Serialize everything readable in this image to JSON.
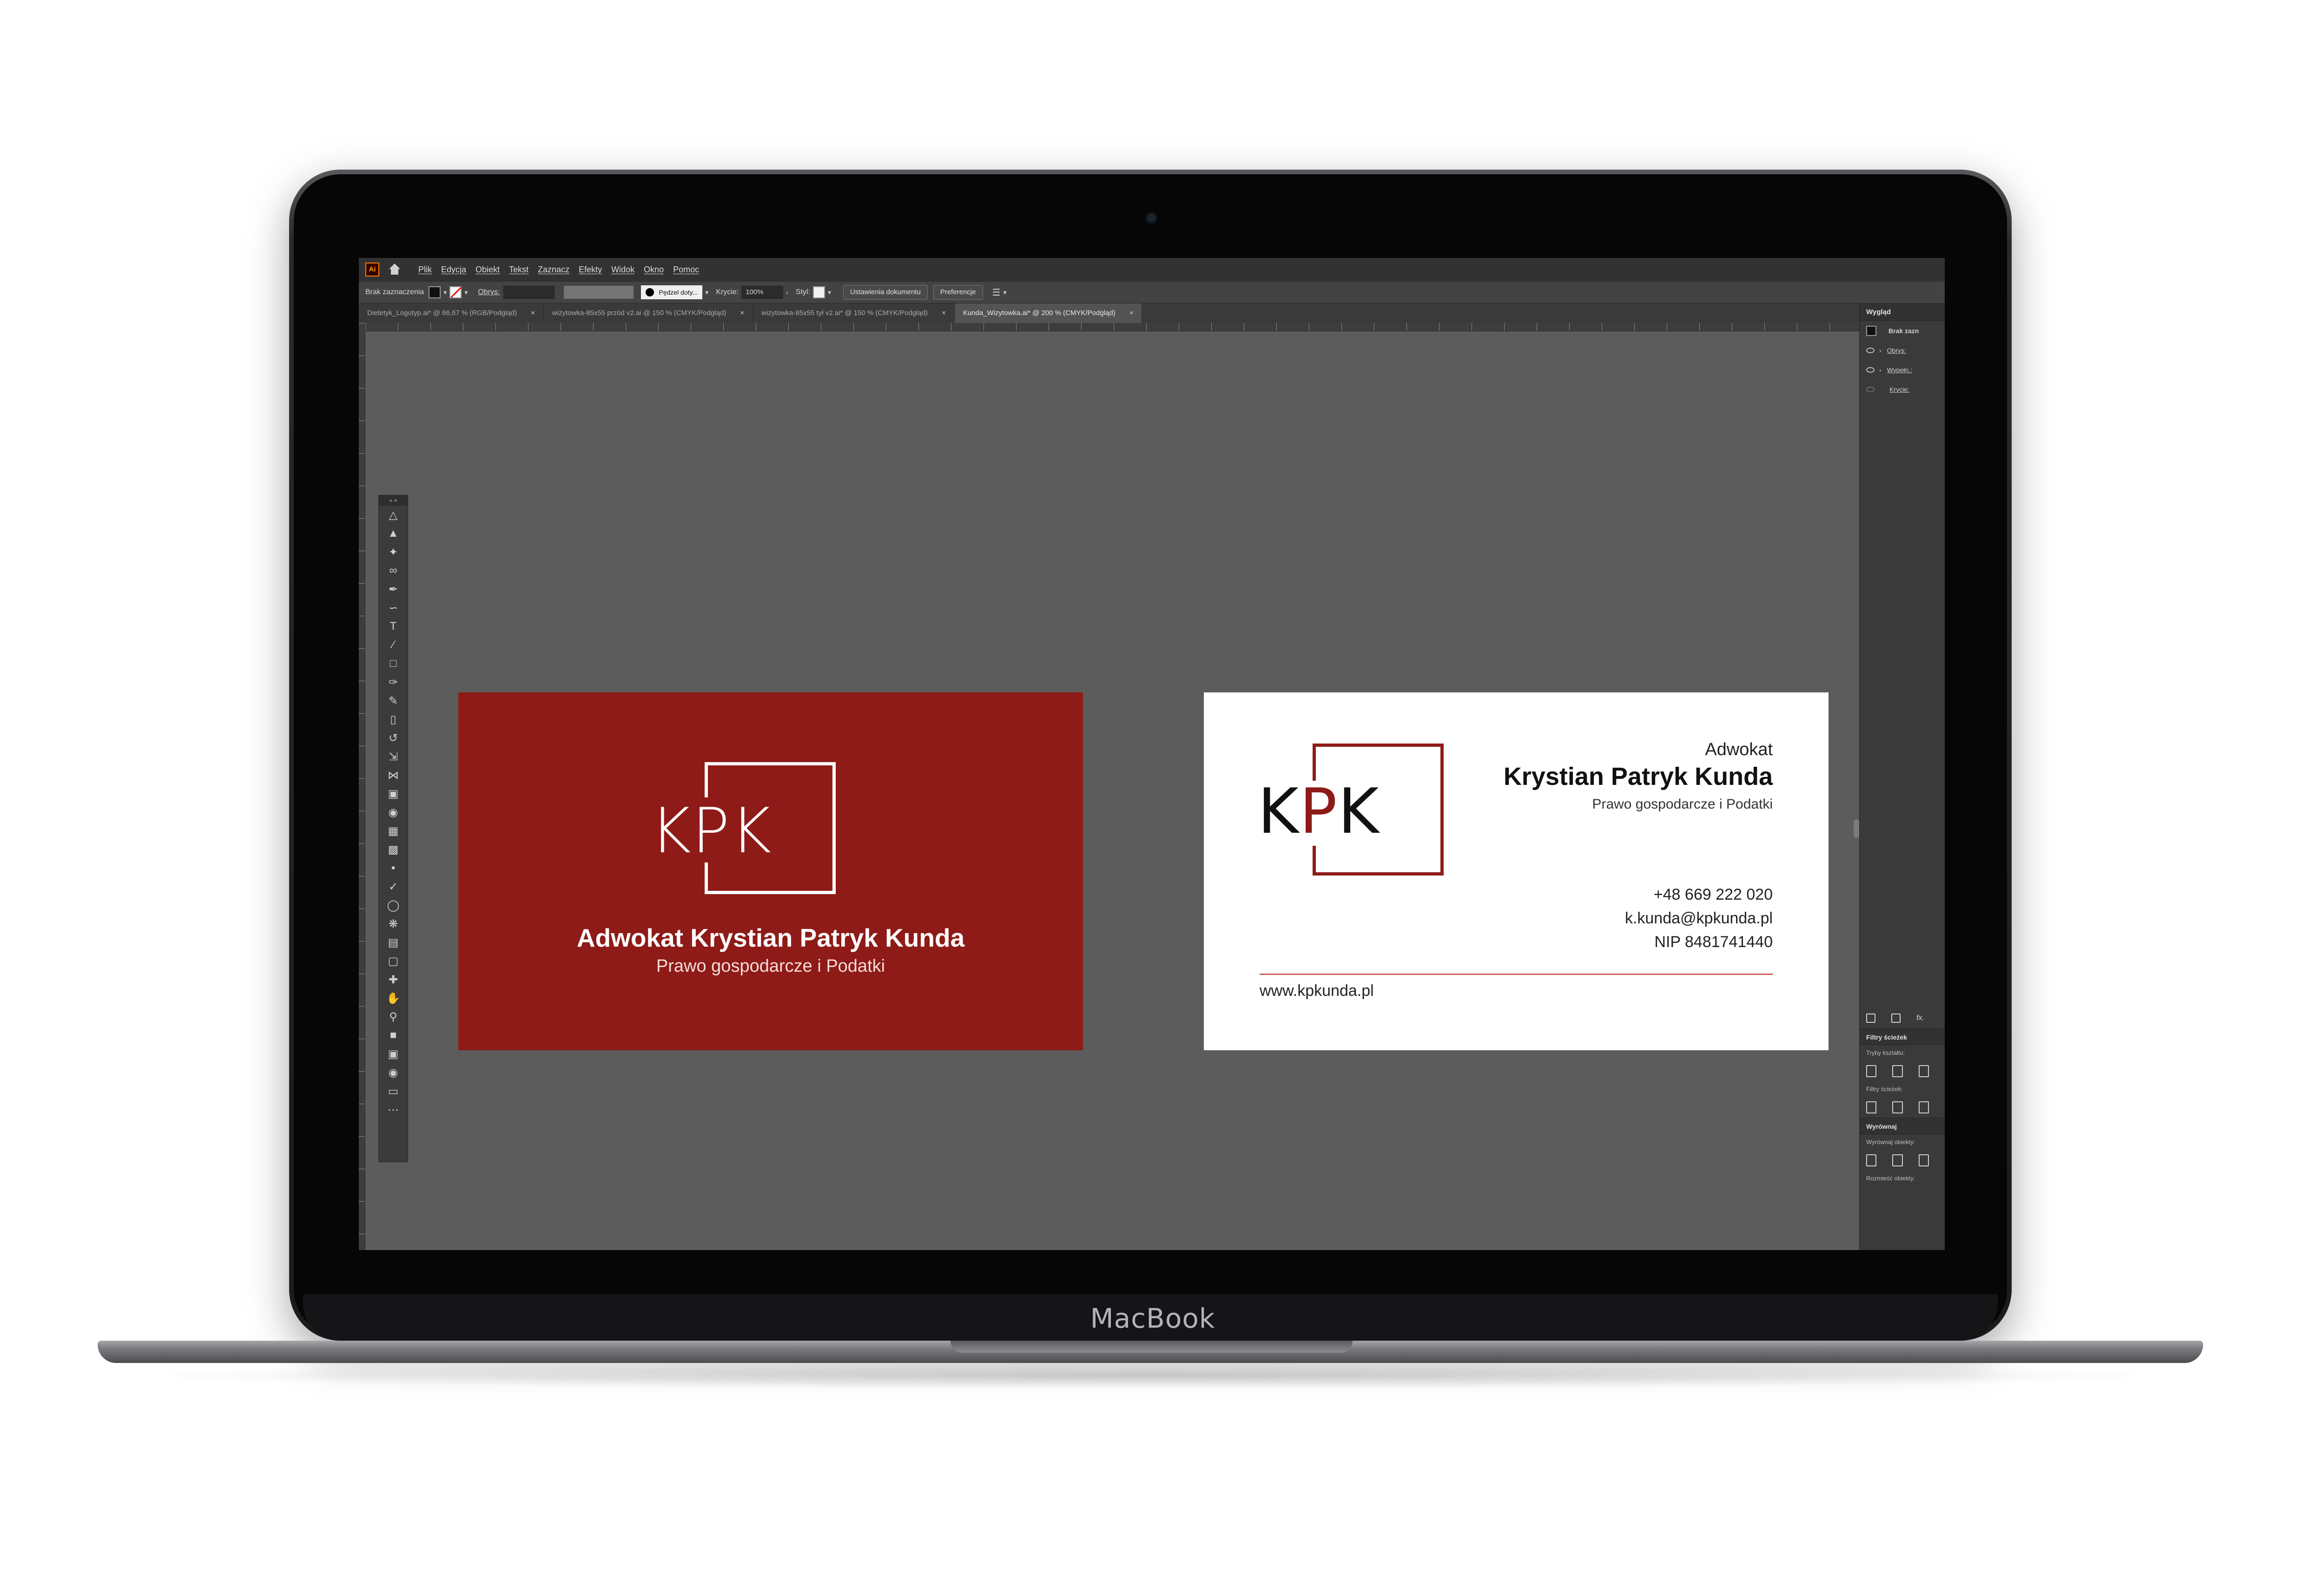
{
  "device": {
    "brand": "MacBook"
  },
  "app": {
    "logo": "Ai",
    "menu": [
      "Plik",
      "Edycja",
      "Obiekt",
      "Tekst",
      "Zaznacz",
      "Efekty",
      "Widok",
      "Okno",
      "Pomoc"
    ]
  },
  "control_bar": {
    "selection": "Brak zaznaczenia",
    "stroke_label": "Obrys:",
    "brush": "Pędzel doty...",
    "opacity_label": "Krycie:",
    "opacity_value": "100%",
    "style_label": "Styl:",
    "doc_settings": "Ustawienia dokumentu",
    "preferences": "Preferencje"
  },
  "tabs": [
    {
      "label": "Dietetyk_Logotyp.ai* @ 66,67 % (RGB/Podgląd)",
      "active": false
    },
    {
      "label": "wizytowka-85x55 przód v2.ai @ 150 % (CMYK/Podgląd)",
      "active": false
    },
    {
      "label": "wizytowka-85x55 tył v2.ai* @ 150 % (CMYK/Podgląd)",
      "active": false
    },
    {
      "label": "Kunda_Wizytowka.ai* @ 200 % (CMYK/Podgląd)",
      "active": true
    }
  ],
  "card_front": {
    "logo": "KPK",
    "name": "Adwokat Krystian Patryk Kunda",
    "subtitle": "Prawo gospodarcze i Podatki",
    "bg_color": "#8e1b17"
  },
  "card_back": {
    "logo": "KPK",
    "title": "Adwokat",
    "name": "Krystian Patryk Kunda",
    "subtitle": "Prawo gospodarcze i Podatki",
    "phone": "+48 669 222 020",
    "email": "k.kunda@kpkunda.pl",
    "nip": "NIP 8481741440",
    "website": "www.kpkunda.pl",
    "accent_color": "#8e1b17"
  },
  "right_panel": {
    "appearance_tab": "Wygląd",
    "no_selection": "Brak zazn",
    "stroke": "Obrys:",
    "fill": "Wypełn.:",
    "opacity": "Krycie:",
    "pathfinder_tab": "Filtry ścieżek",
    "shape_modes": "Tryby kształtu:",
    "pathfinders": "Filtry ścieżek:",
    "align_tab": "Wyrównaj",
    "align_objects": "Wyrównaj obiekty:",
    "distribute_objects": "Rozmieść obiekty:"
  }
}
